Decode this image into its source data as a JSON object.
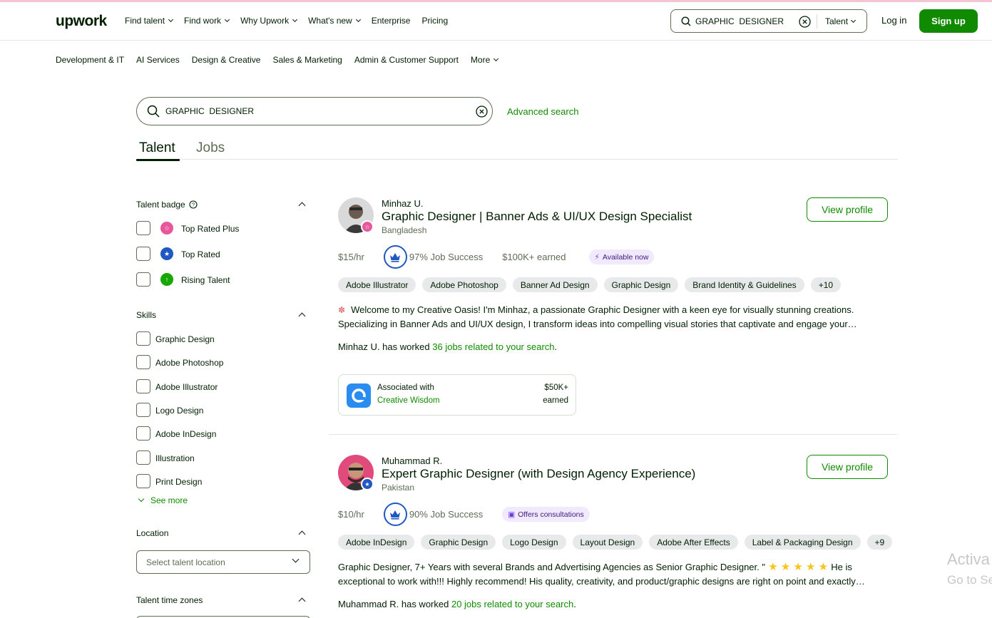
{
  "header": {
    "logo": "upwork",
    "nav": [
      "Find talent",
      "Find work",
      "Why Upwork",
      "What's new",
      "Enterprise",
      "Pricing"
    ],
    "search_value": "GRAPHIC  DESIGNER",
    "search_scope": "Talent",
    "login": "Log in",
    "signup": "Sign up"
  },
  "categories": [
    "Development & IT",
    "AI Services",
    "Design & Creative",
    "Sales & Marketing",
    "Admin & Customer Support",
    "More"
  ],
  "main_search": {
    "value": "GRAPHIC  DESIGNER",
    "advanced": "Advanced search"
  },
  "tabs": [
    "Talent",
    "Jobs"
  ],
  "filters": {
    "badge_title": "Talent badge",
    "badges": [
      "Top Rated Plus",
      "Top Rated",
      "Rising Talent"
    ],
    "skills_title": "Skills",
    "skills": [
      "Graphic Design",
      "Adobe Photoshop",
      "Adobe Illustrator",
      "Logo Design",
      "Adobe InDesign",
      "Illustration",
      "Print Design"
    ],
    "see_more": "See more",
    "location_title": "Location",
    "location_placeholder": "Select talent location",
    "timezones_title": "Talent time zones"
  },
  "results": [
    {
      "name": "Minhaz U.",
      "title": "Graphic Designer | Banner Ads & UI/UX Design Specialist",
      "country": "Bangladesh",
      "view": "View profile",
      "rate": "$15/hr",
      "job_success": "97% Job Success",
      "earned": "$100K+ earned",
      "tag": "Available now",
      "skills": [
        "Adobe Illustrator",
        "Adobe Photoshop",
        "Banner Ad Design",
        "Graphic Design",
        "Brand Identity & Guidelines",
        "+10"
      ],
      "desc1": "Welcome to my Creative Oasis! I'm Minhaz, a passionate Graphic Designer with a keen eye for visually stunning creations.",
      "desc2": "Specializing in Banner Ads and UI/UX design, I transform ideas into compelling visual stories that captivate and engage your…",
      "worked_prefix": "Minhaz U. has worked",
      "worked_link": "36 jobs related to your search",
      "assoc_label": "Associated with",
      "assoc_name": "Creative Wisdom",
      "assoc_amount": "$50K+",
      "assoc_earned": "earned"
    },
    {
      "name": "Muhammad R.",
      "title": "Expert Graphic Designer (with Design Agency Experience)",
      "country": "Pakistan",
      "view": "View profile",
      "rate": "$10/hr",
      "job_success": "90% Job Success",
      "tag": "Offers consultations",
      "skills": [
        "Adobe InDesign",
        "Graphic Design",
        "Logo Design",
        "Layout Design",
        "Adobe After Effects",
        "Label & Packaging Design",
        "+9"
      ],
      "desc1": "Graphic Designer, 7+ Years with several Brands and Advertising Agencies as Senior Graphic Designer. \"",
      "desc1_end": "He is",
      "desc2": "exceptional to work with!!! Highly recommend! His quality, creativity, and product/graphic designs are right on point and exactly…",
      "worked_prefix": "Muhammad R. has worked",
      "worked_link": "20 jobs related to your search"
    }
  ],
  "watermark": {
    "line1": "Activa",
    "line2": "Go to Se"
  },
  "colors": {
    "brand": "#108a00",
    "text": "#001e00",
    "job_success": "#1f57c3",
    "top_rated_plus": "#e8579d",
    "top_rated": "#1f57c3",
    "rising_talent": "#14a800"
  }
}
